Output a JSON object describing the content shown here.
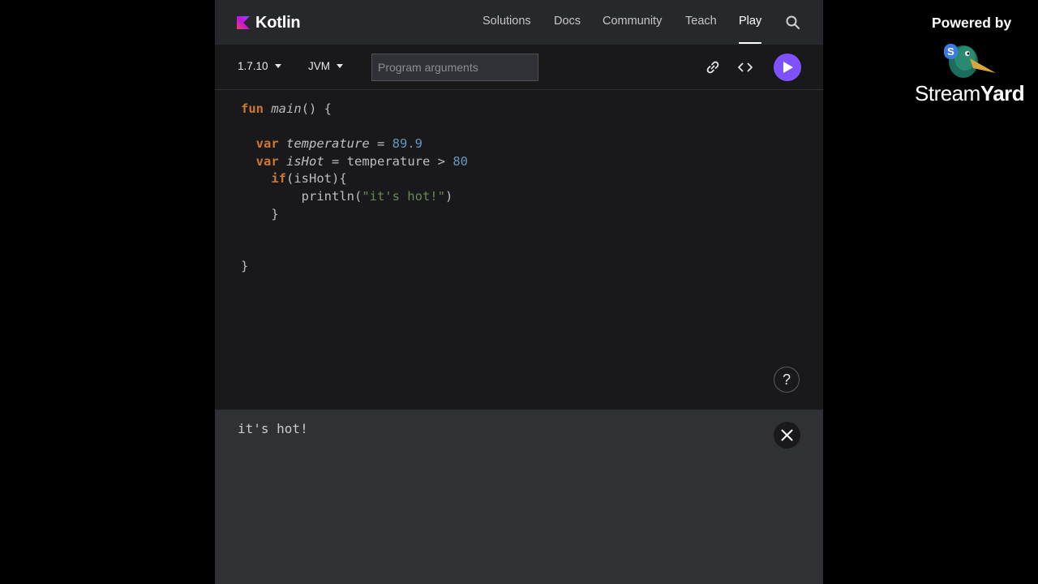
{
  "nav": {
    "brand": "Kotlin",
    "links": [
      "Solutions",
      "Docs",
      "Community",
      "Teach",
      "Play"
    ],
    "active": "Play"
  },
  "toolbar": {
    "version": "1.7.10",
    "platform": "JVM",
    "args_placeholder": "Program arguments"
  },
  "editor": {
    "lines": [
      "fun main() {",
      "",
      "  var temperature = 89.9",
      "  var isHot = temperature > 80",
      "    if(isHot){",
      "        println(\"it's hot!\")",
      "    }",
      "",
      "",
      "}"
    ]
  },
  "help_label": "?",
  "output": {
    "text": "it's hot!"
  },
  "overlay": {
    "powered_by": "Powered by",
    "brand_regular": "Stream",
    "brand_bold": "Yard"
  },
  "colors": {
    "accent": "#7f52ff",
    "keyword": "#cc7832",
    "number": "#6897bb",
    "string": "#6a8759"
  }
}
